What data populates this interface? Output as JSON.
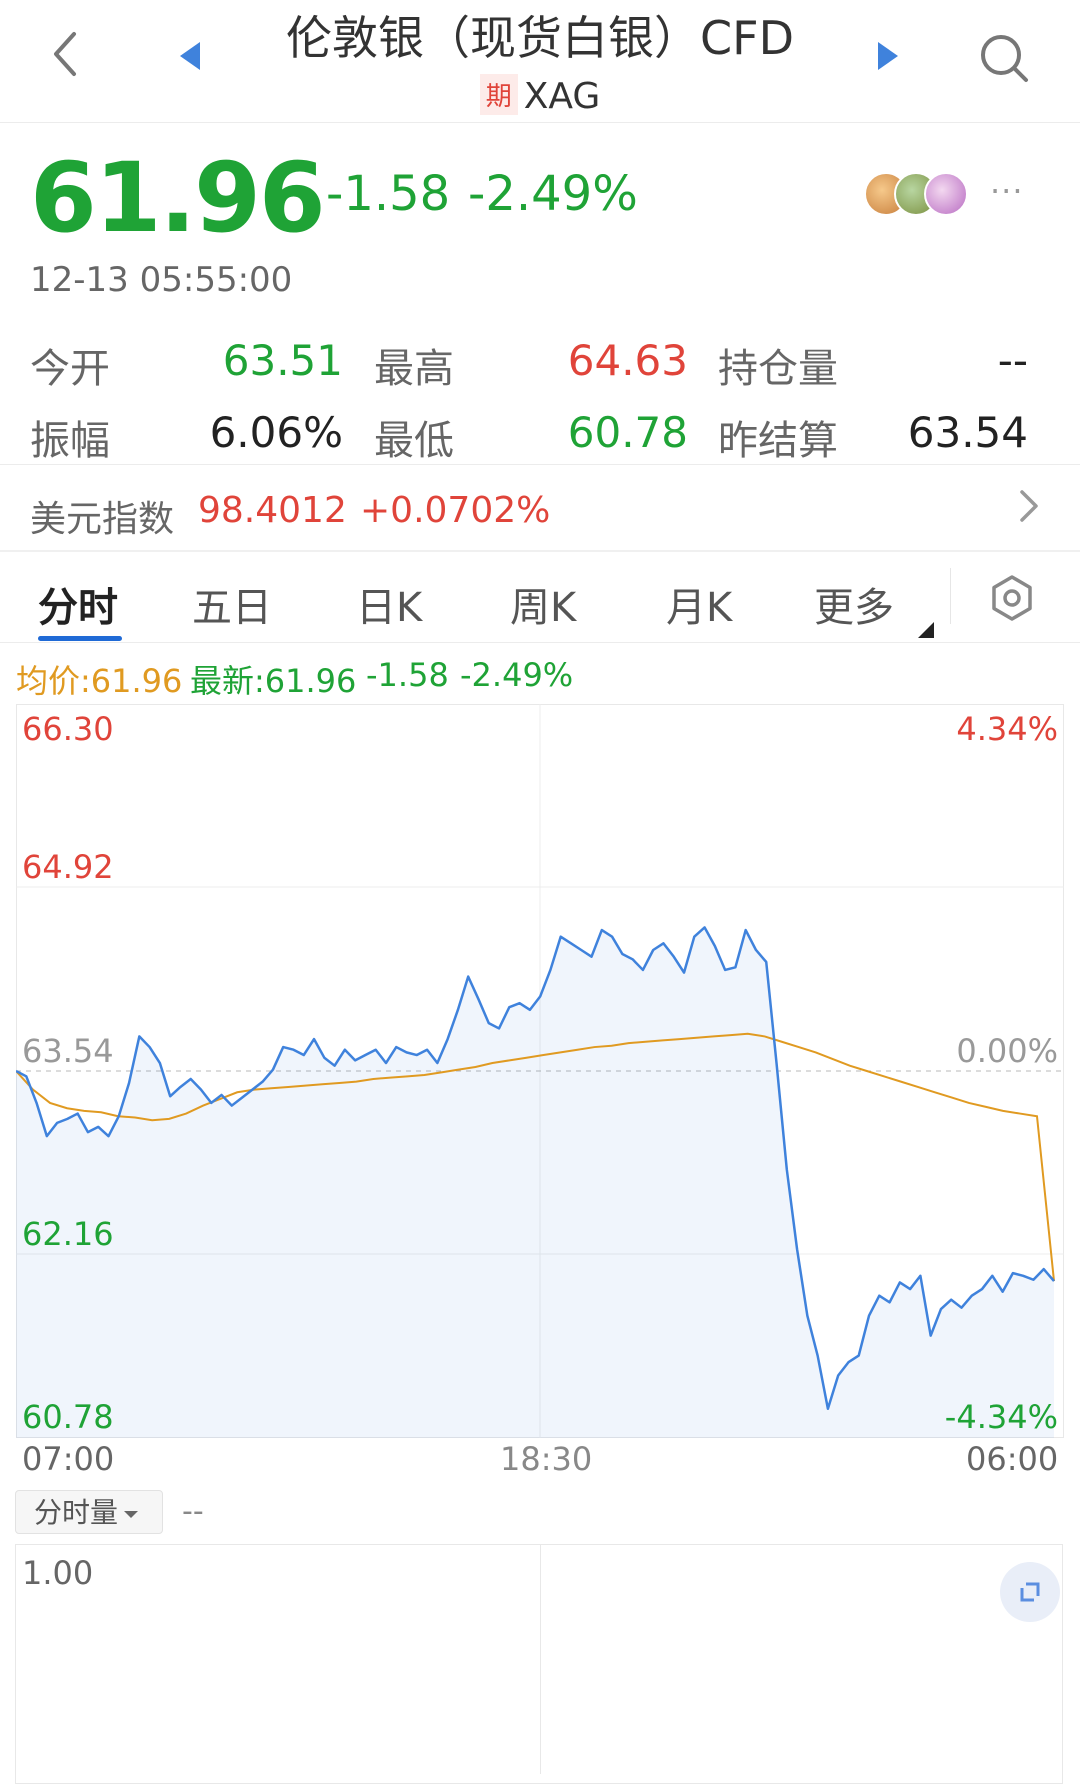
{
  "header": {
    "title": "伦敦银（现货白银）CFD",
    "tag": "期",
    "symbol": "XAG"
  },
  "quote": {
    "price": "61.96",
    "change": "-1.58",
    "change_pct": "-2.49%",
    "time": "12-13 05:55:00",
    "more": "···"
  },
  "stats": [
    {
      "label": "今开",
      "value": "63.51"
    },
    {
      "label": "最高",
      "value": "64.63"
    },
    {
      "label": "持仓量",
      "value": "--"
    },
    {
      "label": "振幅",
      "value": "6.06%"
    },
    {
      "label": "最低",
      "value": "60.78"
    },
    {
      "label": "昨结算",
      "value": "63.54"
    }
  ],
  "dollar_index": {
    "label": "美元指数",
    "value": "98.4012",
    "change_pct": "+0.0702%"
  },
  "tabs": [
    "分时",
    "五日",
    "日K",
    "周K",
    "月K",
    "更多"
  ],
  "legend": {
    "avg": "均价:61.96",
    "last": "最新:61.96",
    "change": "-1.58",
    "change_pct": "-2.49%"
  },
  "volume": {
    "label": "分时量",
    "value": "--",
    "max_label": "1.00"
  },
  "colors": {
    "up": "#e0443a",
    "down": "#1fa336",
    "price_line": "#3f82dc",
    "avg_line": "#e09a21",
    "accent": "#1f6ad6"
  },
  "chart_data": {
    "type": "line",
    "y_left_ticks": [
      "66.30",
      "64.92",
      "63.54",
      "62.16",
      "60.78"
    ],
    "y_right_ticks": [
      "4.34%",
      "0.00%",
      "-4.34%"
    ],
    "x_ticks": [
      "07:00",
      "18:30",
      "06:00"
    ],
    "ylim": [
      60.78,
      66.3
    ],
    "prev_settle": 63.54,
    "series": [
      {
        "values": [
          63.54,
          63.5,
          63.3,
          63.05,
          63.15,
          63.18,
          63.22,
          63.08,
          63.12,
          63.05,
          63.2,
          63.45,
          63.8,
          63.72,
          63.6,
          63.35,
          63.42,
          63.48,
          63.4,
          63.3,
          63.36,
          63.28,
          63.34,
          63.4,
          63.46,
          63.55,
          63.72,
          63.7,
          63.66,
          63.78,
          63.64,
          63.58,
          63.7,
          63.62,
          63.66,
          63.7,
          63.6,
          63.72,
          63.68,
          63.66,
          63.7,
          63.6,
          63.78,
          64.0,
          64.25,
          64.08,
          63.9,
          63.86,
          64.02,
          64.05,
          64.0,
          64.1,
          64.3,
          64.55,
          64.5,
          64.45,
          64.4,
          64.6,
          64.55,
          64.42,
          64.38,
          64.3,
          64.45,
          64.5,
          64.4,
          64.28,
          64.55,
          64.62,
          64.48,
          64.3,
          64.32,
          64.6,
          64.45,
          64.36,
          63.6,
          62.8,
          62.2,
          61.7,
          61.4,
          61.0,
          61.25,
          61.35,
          61.4,
          61.7,
          61.85,
          61.8,
          61.95,
          61.9,
          62.0,
          61.55,
          61.75,
          61.82,
          61.76,
          61.85,
          61.9,
          62.0,
          61.88,
          62.02,
          62.0,
          61.97,
          62.05,
          61.96
        ]
      },
      {
        "values": [
          63.54,
          63.4,
          63.3,
          63.26,
          63.24,
          63.23,
          63.2,
          63.19,
          63.17,
          63.18,
          63.22,
          63.28,
          63.33,
          63.38,
          63.4,
          63.41,
          63.42,
          63.43,
          63.44,
          63.45,
          63.46,
          63.48,
          63.49,
          63.5,
          63.51,
          63.53,
          63.55,
          63.57,
          63.6,
          63.62,
          63.64,
          63.66,
          63.68,
          63.7,
          63.72,
          63.73,
          63.75,
          63.76,
          63.77,
          63.78,
          63.79,
          63.8,
          63.81,
          63.82,
          63.8,
          63.76,
          63.72,
          63.68,
          63.63,
          63.58,
          63.54,
          63.5,
          63.46,
          63.42,
          63.38,
          63.34,
          63.3,
          63.27,
          63.24,
          63.22,
          63.2,
          61.96
        ]
      }
    ]
  }
}
